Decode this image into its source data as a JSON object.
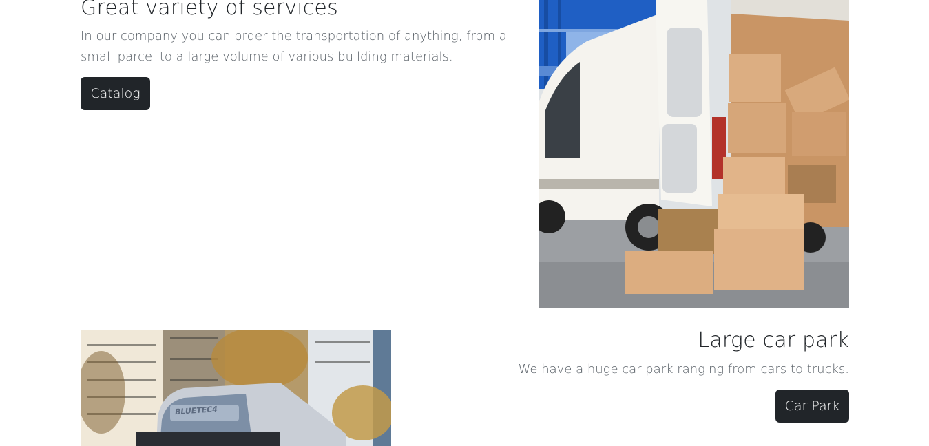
{
  "services": {
    "title": "Great variety of services",
    "description": "In our company you can order the transportation of anything, from a small parcel to a large volume of various building materials.",
    "button_label": "Catalog",
    "image": "van-with-boxes-photo"
  },
  "car_park": {
    "title": "Large car park",
    "description": "We have a huge car park ranging from cars to trucks.",
    "button_label": "Car Park",
    "image": "truck-in-city-photo",
    "truck_label": "BLUETEC4"
  },
  "colors": {
    "button_bg": "#212529",
    "button_text": "#ffffff",
    "heading": "#212529",
    "body_text": "#5c636a",
    "divider": "#cfd2d5"
  }
}
